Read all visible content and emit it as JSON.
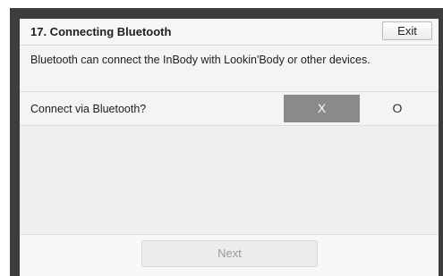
{
  "header": {
    "title": "17. Connecting Bluetooth",
    "exit_label": "Exit"
  },
  "description": {
    "text": "Bluetooth can connect the InBody with Lookin'Body or other devices."
  },
  "bluetooth_setting": {
    "question": "Connect via Bluetooth?",
    "options": [
      "X",
      "O"
    ],
    "selected": "X"
  },
  "footer": {
    "next_label": "Next"
  },
  "colors": {
    "bezel": "#3d3d3d",
    "selected_toggle": "#8a8a8a",
    "screen_background": "#f1f1f1"
  }
}
